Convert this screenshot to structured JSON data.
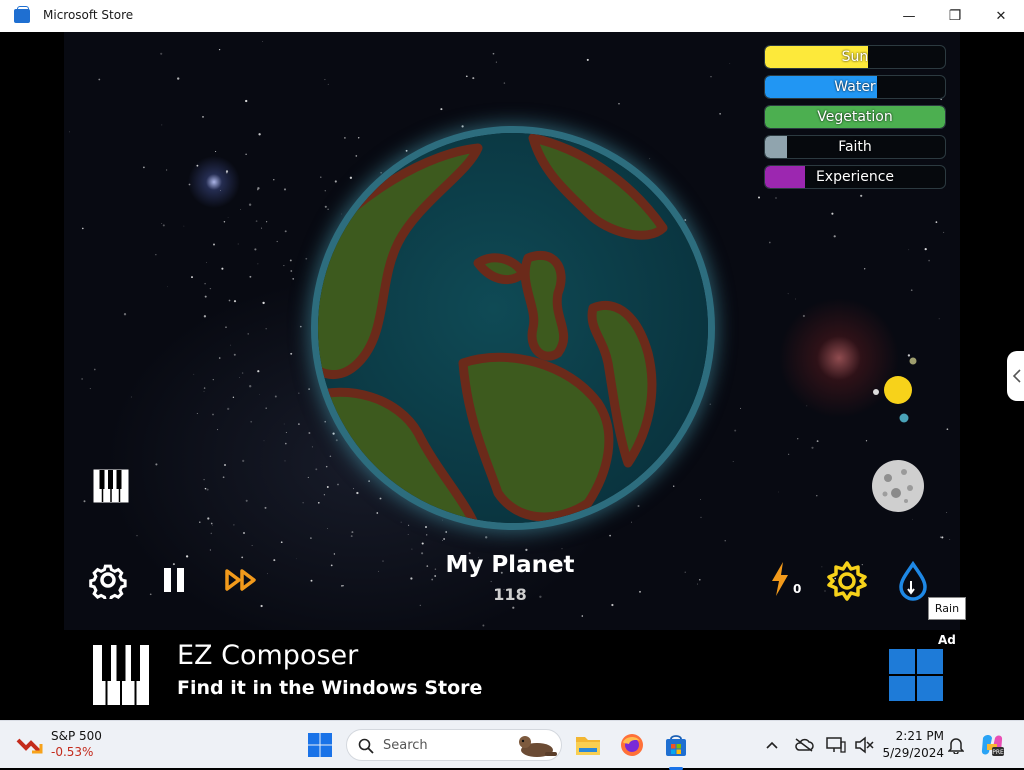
{
  "window": {
    "title": "Microsoft Store",
    "minimize_glyph": "—",
    "maximize_glyph": "❐",
    "close_glyph": "✕"
  },
  "status_bars": [
    {
      "label": "Sun",
      "level": 0.57,
      "color": "#fde93a"
    },
    {
      "label": "Water",
      "level": 0.62,
      "color": "#2196f3"
    },
    {
      "label": "Vegetation",
      "level": 1.0,
      "color": "#4caf50"
    },
    {
      "label": "Faith",
      "level": 0.12,
      "color": "#90a4ae"
    },
    {
      "label": "Experience",
      "level": 0.22,
      "color": "#9c27b0"
    }
  ],
  "planet": {
    "name": "My Planet",
    "score": "118"
  },
  "energy": {
    "count": "0"
  },
  "tooltip": {
    "text": "Rain"
  },
  "ad": {
    "title": "EZ Composer",
    "subtitle": "Find it in the Windows Store",
    "badge": "Ad"
  },
  "taskbar": {
    "stock_name": "S&P 500",
    "stock_change": "-0.53%",
    "search_placeholder": "Search",
    "time": "2:21 PM",
    "date": "5/29/2024"
  },
  "colors": {
    "accent_yellow": "#f7d21a",
    "accent_orange": "#f29a1b",
    "rain_blue": "#1e88e5"
  }
}
